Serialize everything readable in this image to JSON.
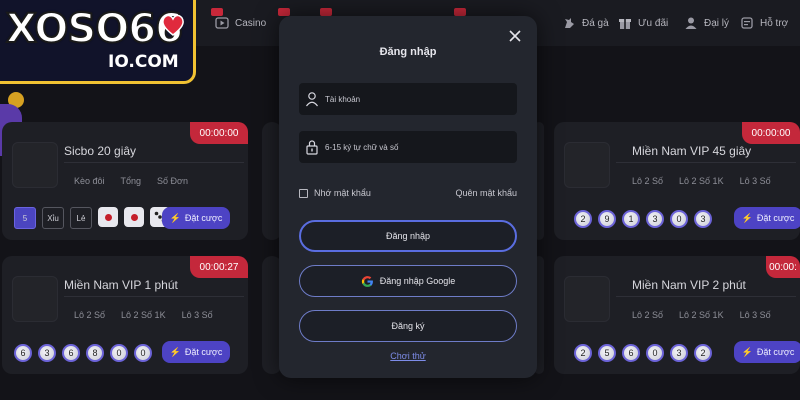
{
  "logo": {
    "main": "XOSO66",
    "sub": "IO.COM"
  },
  "nav": {
    "items": [
      {
        "label": "Casino",
        "icon": "casino-icon"
      },
      {
        "label": "",
        "icon": "slot-icon"
      },
      {
        "label": "",
        "icon": "sport-icon"
      },
      {
        "label": "",
        "icon": "game-icon"
      },
      {
        "label": "",
        "icon": "lottery-icon"
      },
      {
        "label": "Đá gà",
        "icon": "rooster-icon"
      },
      {
        "label": "Ưu đãi",
        "icon": "gift-icon"
      },
      {
        "label": "Đại lý",
        "icon": "agent-icon"
      },
      {
        "label": "Hỗ trợ",
        "icon": "support-icon"
      }
    ]
  },
  "cards": {
    "sicbo": {
      "title": "Sicbo 20 giây",
      "timer": "00:00:00",
      "tabs": [
        "Kèo đôi",
        "Tổng",
        "Số Đơn"
      ],
      "options": [
        "5",
        "Xỉu",
        "Lẻ"
      ],
      "bet_label": "Đặt cược"
    },
    "mien_nam_1": {
      "title": "Miền Nam VIP 1 phút",
      "timer": "00:00:27",
      "tabs": [
        "Lô 2 Số",
        "Lô 2 Số 1K",
        "Lô 3 Số"
      ],
      "balls": [
        "6",
        "3",
        "6",
        "8",
        "0",
        "0"
      ],
      "bet_label": "Đặt cược"
    },
    "mien_nam_45": {
      "title": "Miền Nam VIP 45 giây",
      "timer": "00:00:00",
      "tabs": [
        "Lô 2 Số",
        "Lô 2 Số 1K",
        "Lô 3 Số"
      ],
      "balls": [
        "2",
        "9",
        "1",
        "3",
        "0",
        "3"
      ],
      "bet_label": "Đặt cược"
    },
    "mien_nam_2": {
      "title": "Miền Nam VIP 2 phút",
      "timer": "00:00:",
      "tabs": [
        "Lô 2 Số",
        "Lô 2 Số 1K",
        "Lô 3 Số"
      ],
      "balls": [
        "2",
        "5",
        "6",
        "0",
        "3",
        "2"
      ],
      "bet_label": "Đặt cược"
    }
  },
  "modal": {
    "title": "Đăng nhập",
    "username_placeholder": "Tài khoản",
    "password_placeholder": "6-15 ký tự chữ và số",
    "remember_label": "Nhớ mật khẩu",
    "forgot_label": "Quên mật khẩu",
    "login_label": "Đăng nhập",
    "google_label": "Đăng nhập Google",
    "register_label": "Đăng ký",
    "try_label": "Chơi thử"
  },
  "colors": {
    "background": "#131318",
    "card": "#1e1f25",
    "timer": "#c4283b",
    "bet_button": "#4d43c4",
    "modal": "#23262e",
    "logo_border": "#f1c232"
  }
}
